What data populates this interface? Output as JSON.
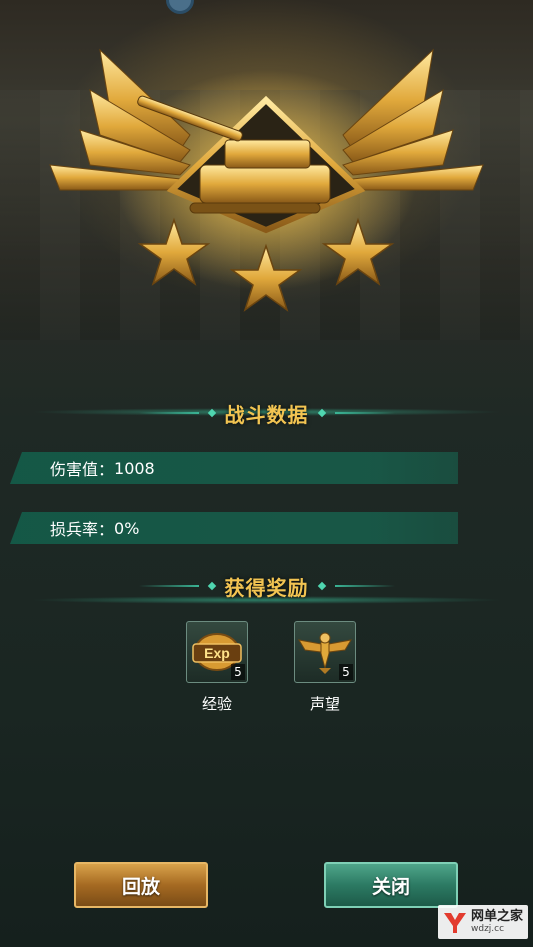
{
  "battle_stats": {
    "title": "战斗数据",
    "damage_label": "伤害值：",
    "damage_value": "1008",
    "loss_label": "损兵率：",
    "loss_value": "0%"
  },
  "rewards": {
    "title": "获得奖励",
    "items": [
      {
        "name": "经验",
        "count": "5",
        "icon": "exp-icon",
        "icon_text": "Exp"
      },
      {
        "name": "声望",
        "count": "5",
        "icon": "eagle-icon"
      }
    ]
  },
  "rank": {
    "stars": 3,
    "emblem_icon": "tank-emblem-icon"
  },
  "buttons": {
    "replay": "回放",
    "close": "关闭"
  },
  "watermark": {
    "brand": "网单之家",
    "url": "wdzj.cc"
  },
  "colors": {
    "gold": "#f2c452",
    "teal": "#3ab495",
    "replay": "#a56a22",
    "close": "#2c7a63"
  }
}
